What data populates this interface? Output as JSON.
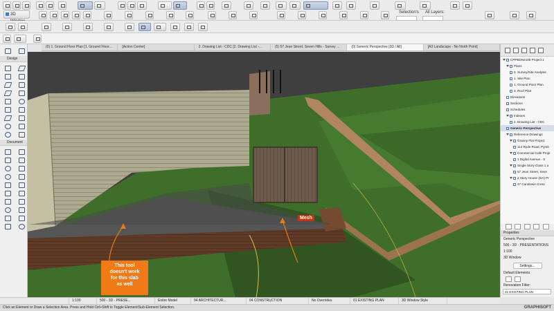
{
  "toolbar": {
    "window_button": "3D Window",
    "selections_label": "Selection's",
    "layers_label": "All Layers:"
  },
  "tabs": [
    "(0) 1. Ground Floor Plan [1. Ground Floor...",
    "[Action Center]",
    "2. Drawing List - CDC [2. Drawing List -...",
    "(5) 57 Jean Street, Seven Hills - Survey ...",
    "(0) Generic Perspective [3D / All]",
    "[A3 Landscape - No North Point]"
  ],
  "toolbox": {
    "design_label": "Design",
    "document_label": "Document"
  },
  "navigator": {
    "items": [
      {
        "label": "CPPBDN4105 Project 1",
        "indent": 0,
        "arrow": true
      },
      {
        "label": "Plans",
        "indent": 1,
        "arrow": true
      },
      {
        "label": "0. Survey/Site Analysis",
        "indent": 2
      },
      {
        "label": "1. Site Plan",
        "indent": 2
      },
      {
        "label": "1. Ground Floor Plan",
        "indent": 2
      },
      {
        "label": "3. Roof Plan",
        "indent": 2
      },
      {
        "label": "Elevations",
        "indent": 1
      },
      {
        "label": "Sections",
        "indent": 1
      },
      {
        "label": "Schedules",
        "indent": 1
      },
      {
        "label": "Indexes",
        "indent": 1,
        "arrow": true
      },
      {
        "label": "2. Drawing List - CDC",
        "indent": 2
      },
      {
        "label": "Generic Perspective",
        "indent": 1,
        "highlight": true
      },
      {
        "label": "Reference Drawings",
        "indent": 1,
        "arrow": true
      },
      {
        "label": "Granny Flat Project",
        "indent": 2,
        "arrow": true
      },
      {
        "label": "114 Ryde Road, Pymb",
        "indent": 3
      },
      {
        "label": "Commercial Cafe Proje",
        "indent": 2,
        "arrow": true
      },
      {
        "label": "1 Digital Avenue - S",
        "indent": 3
      },
      {
        "label": "Single Story Class 1 a",
        "indent": 2,
        "arrow": true
      },
      {
        "label": "57 Jean Street, Seve",
        "indent": 3
      },
      {
        "label": "2 Story House (DA) Pr",
        "indent": 2,
        "arrow": true
      },
      {
        "label": "47 Candowie Cresc",
        "indent": 3
      }
    ]
  },
  "properties": {
    "header": "Properties",
    "view_name": "Generic Perspective",
    "view_id": "500 - 3D - PRESENTATIONS",
    "scale": "1:100",
    "window_type": "3D Window",
    "settings_button": "Settings...",
    "default_elements": "Default Elements:",
    "renovation_filter": "Renovation Filter:",
    "renovation_value": "01 EXISTING PLAN"
  },
  "bottom_bar": [
    "1:100",
    "500 - 3D - PRESE...",
    "Entire Model",
    "04 ARCHITECTUR...",
    "04 CONSTRUCTION",
    "No Overrides",
    "01 EXISTING PLAN",
    "3D Window Style"
  ],
  "status": {
    "message": "Click an Element or Draw a Selection Area. Press and Hold Ctrl+Shift to Toggle Element/Sub-Element Selection.",
    "brand": "GRAPHISOFT"
  },
  "annotations": {
    "mesh_label": "Mesh",
    "note_line1": "This tool",
    "note_line2": "doesn't work",
    "note_line3": "for this slab",
    "note_line4": "as well"
  }
}
